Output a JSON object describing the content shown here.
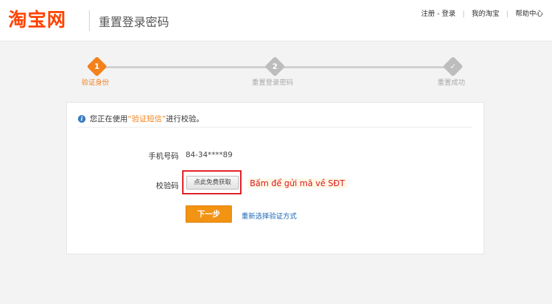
{
  "header": {
    "logo_text": "淘宝网",
    "page_title": "重置登录密码",
    "links": {
      "register_login": "注册 - 登录",
      "my_taobao": "我的淘宝",
      "help_center": "帮助中心"
    },
    "separator": "|"
  },
  "steps": [
    {
      "number": "1",
      "label": "验证身份",
      "state": "active"
    },
    {
      "number": "2",
      "label": "重置登录密码",
      "state": "pending"
    },
    {
      "number": "✓",
      "label": "重置成功",
      "state": "pending"
    }
  ],
  "notice": {
    "prefix": "您正在使用",
    "method": "“验证短信”",
    "suffix": "进行校验。"
  },
  "form": {
    "phone_label": "手机号码",
    "phone_value": "84-34****89",
    "code_label": "校验码",
    "get_code_button": "点此免费获取",
    "next_button": "下一步",
    "reselect_link": "重新选择验证方式"
  },
  "annotation": {
    "text": "Bấm để gửi mã về SĐT"
  },
  "colors": {
    "brand_orange": "#ff4400",
    "accent_orange": "#f3811c",
    "button_orange": "#f39314",
    "link_blue": "#1a66b3",
    "annotation_red": "#e0161c"
  }
}
